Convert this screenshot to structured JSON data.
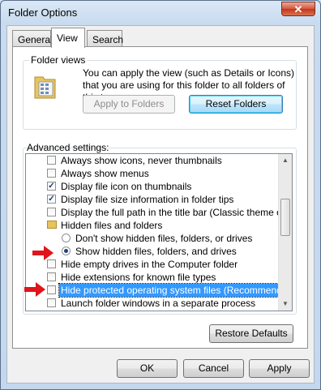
{
  "window": {
    "title": "Folder Options",
    "close_label": "✕"
  },
  "tabs": [
    {
      "label": "General"
    },
    {
      "label": "View"
    },
    {
      "label": "Search"
    }
  ],
  "folder_views": {
    "group_label": "Folder views",
    "description": "You can apply the view (such as Details or Icons) that you are using for this folder to all folders of this type.",
    "apply_label": "Apply to Folders",
    "reset_label": "Reset Folders"
  },
  "advanced": {
    "label": "Advanced settings:",
    "items": [
      {
        "text": "Always show icons, never thumbnails",
        "kind": "checkbox",
        "checked": false
      },
      {
        "text": "Always show menus",
        "kind": "checkbox",
        "checked": false
      },
      {
        "text": "Display file icon on thumbnails",
        "kind": "checkbox",
        "checked": true
      },
      {
        "text": "Display file size information in folder tips",
        "kind": "checkbox",
        "checked": true
      },
      {
        "text": "Display the full path in the title bar (Classic theme only)",
        "kind": "checkbox",
        "checked": false
      },
      {
        "text": "Hidden files and folders",
        "kind": "folder"
      },
      {
        "text": "Don't show hidden files, folders, or drives",
        "kind": "radio",
        "checked": false
      },
      {
        "text": "Show hidden files, folders, and drives",
        "kind": "radio",
        "checked": true
      },
      {
        "text": "Hide empty drives in the Computer folder",
        "kind": "checkbox",
        "checked": false
      },
      {
        "text": "Hide extensions for known file types",
        "kind": "checkbox",
        "checked": false
      },
      {
        "text": "Hide protected operating system files (Recommended)",
        "kind": "checkbox",
        "checked": false,
        "selected": true
      },
      {
        "text": "Launch folder windows in a separate process",
        "kind": "checkbox",
        "checked": false
      }
    ],
    "restore_label": "Restore Defaults"
  },
  "footer": {
    "ok_label": "OK",
    "cancel_label": "Cancel",
    "apply_label": "Apply"
  },
  "colors": {
    "selection": "#3399ff",
    "arrow": "#e0141b"
  },
  "icons": {
    "close": "close-icon",
    "folder": "folder-icon",
    "annotation": "red-arrow-icon"
  }
}
